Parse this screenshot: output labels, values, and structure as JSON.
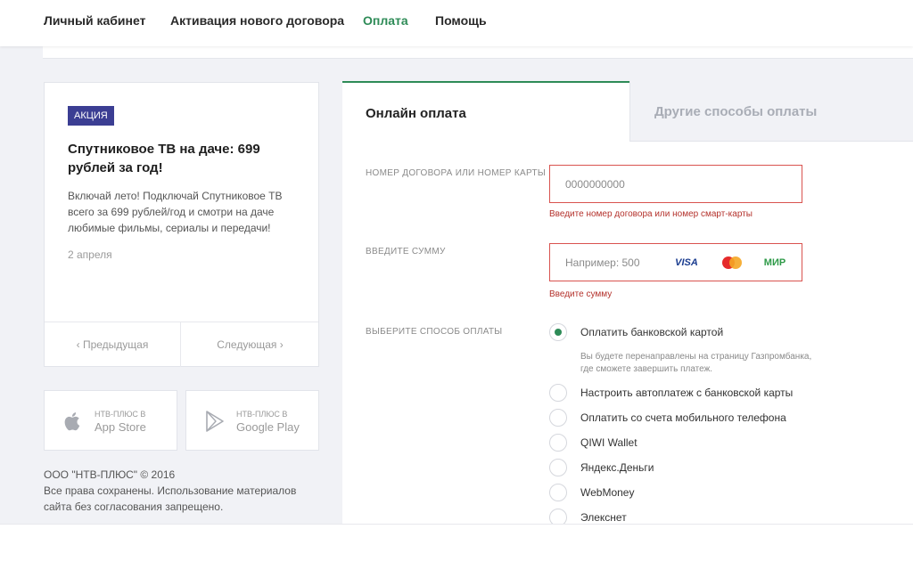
{
  "nav": {
    "items": [
      {
        "label": "Личный кабинет"
      },
      {
        "label": "Активация нового договора"
      },
      {
        "label": "Оплата",
        "active": true
      },
      {
        "label": "Помощь"
      }
    ]
  },
  "promo": {
    "badge": "АКЦИЯ",
    "title": "Спутниковое ТВ на даче: 699 рублей за год!",
    "text": "Включай лето! Подключай Спутниковое ТВ всего за 699 рублей/год и смотри на даче любимые фильмы, сериалы и передачи!",
    "date": "2 апреля",
    "prev_label": "‹  Предыдущая",
    "next_label": "Следующая  ›"
  },
  "stores": {
    "app_store": {
      "small": "НТВ-ПЛЮС В",
      "name": "App Store"
    },
    "google_play": {
      "small": "НТВ-ПЛЮС В",
      "name": "Google Play"
    }
  },
  "footer": {
    "line1": "ООО \"НТВ-ПЛЮС\" © 2016",
    "line2": "Все права сохранены. Использование материалов",
    "line3": "сайта без согласования запрещено."
  },
  "payment": {
    "tab_online": "Онлайн оплата",
    "tab_other": "Другие способы оплаты",
    "contract_label": "НОМЕР ДОГОВОРА ИЛИ НОМЕР КАРТЫ",
    "contract_placeholder": "0000000000",
    "contract_error": "Введите номер договора или номер смарт-карты",
    "amount_label": "ВВЕДИТЕ СУММУ",
    "amount_placeholder": "Например: 500",
    "amount_error": "Введите сумму",
    "cards": {
      "visa": "VISA",
      "mir": "МИР"
    },
    "method_label": "ВЫБЕРИТЕ СПОСОБ ОПЛАТЫ",
    "methods": [
      {
        "label": "Оплатить банковской картой",
        "selected": true
      },
      {
        "label": "Настроить автоплатеж с банковской карты",
        "selected": false
      },
      {
        "label": "Оплатить со счета мобильного телефона",
        "selected": false
      },
      {
        "label": "QIWI Wallet",
        "selected": false
      },
      {
        "label": "Яндекс.Деньги",
        "selected": false
      },
      {
        "label": "WebMoney",
        "selected": false
      },
      {
        "label": "Элекснет",
        "selected": false
      }
    ],
    "bank_note": "Вы будете перенаправлены на страницу Газпромбанка, где сможете завершить платеж."
  },
  "colors": {
    "accent": "#2e8b57",
    "badge": "#3b3e93",
    "error": "#d9534f"
  },
  "icons": [
    "apple-icon",
    "google-play-icon",
    "mastercard-icon"
  ]
}
